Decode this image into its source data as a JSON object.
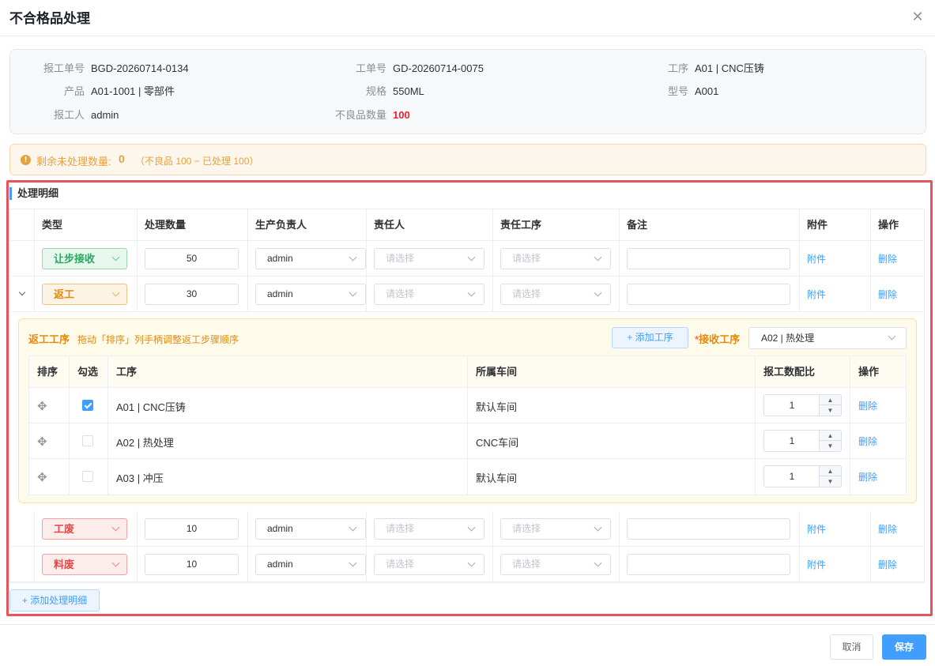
{
  "dialog": {
    "title": "不合格品处理",
    "close_icon": "close-icon"
  },
  "info": {
    "report_no_label": "报工单号",
    "report_no": "BGD-20260714-0134",
    "work_order_label": "工单号",
    "work_order": "GD-20260714-0075",
    "process_label": "工序",
    "process": "A01 | CNC压铸",
    "product_label": "产品",
    "product": "A01-1001 | 零部件",
    "spec_label": "规格",
    "spec": "550ML",
    "model_label": "型号",
    "model": "A001",
    "reporter_label": "报工人",
    "reporter": "admin",
    "defect_qty_label": "不良品数量",
    "defect_qty": "100"
  },
  "alert": {
    "icon": "exclamation-icon",
    "text": "剩余未处理数量:",
    "remaining": "0",
    "detail": "（不良品 100 − 已处理 100）"
  },
  "section": {
    "title": "处理明细"
  },
  "table": {
    "headers": [
      "类型",
      "处理数量",
      "生产负责人",
      "责任人",
      "责任工序",
      "备注",
      "附件",
      "操作"
    ],
    "placeholder": "请选择",
    "attach_label": "附件",
    "delete_label": "删除",
    "rows": [
      {
        "type": "让步接收",
        "qty": "50",
        "manager": "admin"
      },
      {
        "type": "返工",
        "qty": "30",
        "manager": "admin"
      },
      {
        "type": "工废",
        "qty": "10",
        "manager": "admin"
      },
      {
        "type": "料废",
        "qty": "10",
        "manager": "admin"
      }
    ]
  },
  "rework": {
    "title": "返工工序",
    "hint": "拖动「排序」列手柄调整返工步骤顺序",
    "add_label": "+ 添加工序",
    "receive_star": "*",
    "receive_label": "接收工序",
    "receive_value": "A02 | 热处理",
    "headers": [
      "排序",
      "勾选",
      "工序",
      "所属车间",
      "报工数配比",
      "操作"
    ],
    "delete_label": "删除",
    "rows": [
      {
        "checked": true,
        "process": "A01 | CNC压铸",
        "workshop": "默认车间",
        "ratio": "1"
      },
      {
        "checked": false,
        "process": "A02 | 热处理",
        "workshop": "CNC车间",
        "ratio": "1"
      },
      {
        "checked": false,
        "process": "A03 | 冲压",
        "workshop": "默认车间",
        "ratio": "1"
      }
    ]
  },
  "add_detail_label": "+ 添加处理明细",
  "footer": {
    "cancel_label": "取消",
    "save_label": "保存"
  }
}
